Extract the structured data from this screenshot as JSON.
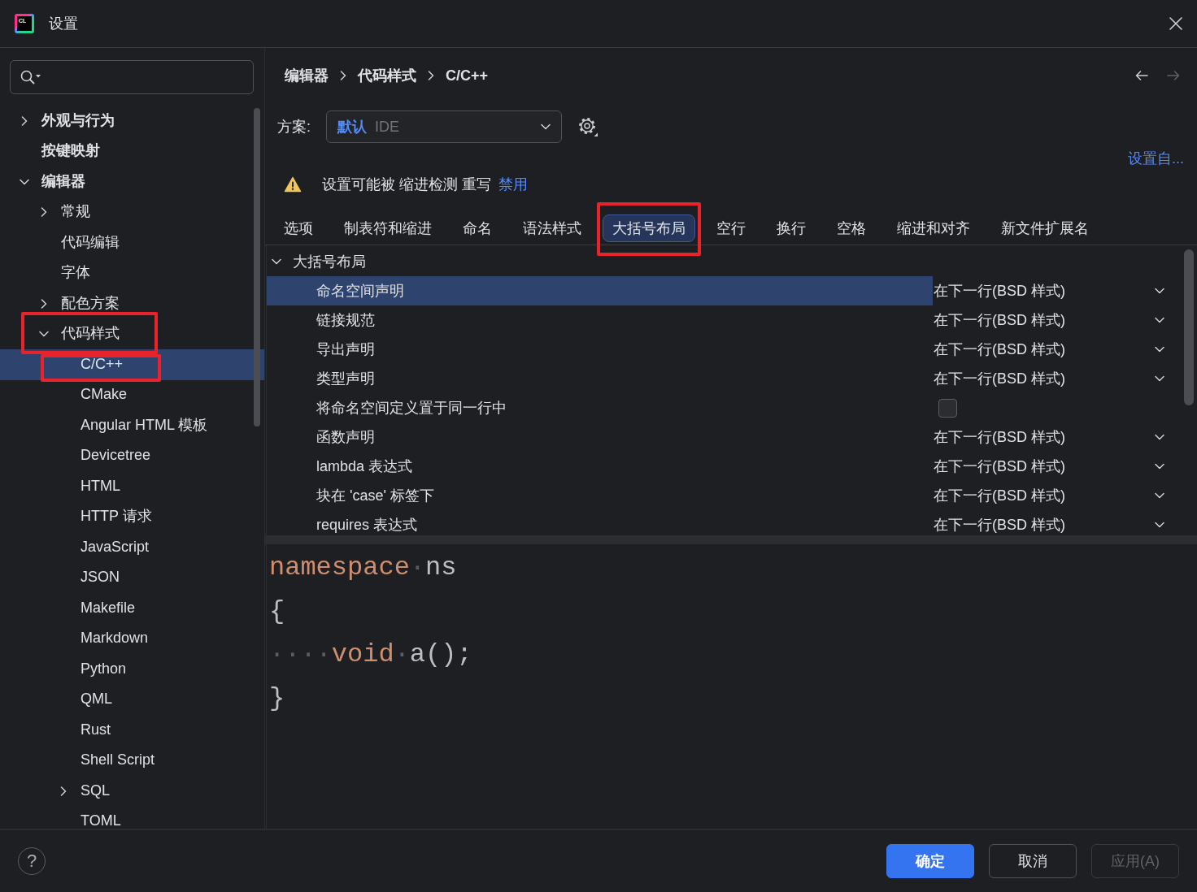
{
  "window": {
    "icon_text": "CL",
    "title": "设置"
  },
  "sidebar": {
    "tree": [
      {
        "label": "外观与行为",
        "expanded": false,
        "selected": false
      },
      {
        "label": "按键映射",
        "selected": false
      },
      {
        "label": "编辑器",
        "expanded": true,
        "selected": false,
        "children": [
          {
            "label": "常规",
            "expanded": false,
            "selected": false
          },
          {
            "label": "代码编辑",
            "selected": false
          },
          {
            "label": "字体",
            "selected": false
          },
          {
            "label": "配色方案",
            "expanded": false,
            "selected": false
          },
          {
            "label": "代码样式",
            "expanded": true,
            "selected": false,
            "annotated": true,
            "children": [
              {
                "label": "C/C++",
                "selected": true,
                "annotated": true
              },
              {
                "label": "CMake",
                "selected": false
              },
              {
                "label": "Angular HTML 模板",
                "selected": false
              },
              {
                "label": "Devicetree",
                "selected": false
              },
              {
                "label": "HTML",
                "selected": false
              },
              {
                "label": "HTTP 请求",
                "selected": false
              },
              {
                "label": "JavaScript",
                "selected": false
              },
              {
                "label": "JSON",
                "selected": false
              },
              {
                "label": "Makefile",
                "selected": false
              },
              {
                "label": "Markdown",
                "selected": false
              },
              {
                "label": "Python",
                "selected": false
              },
              {
                "label": "QML",
                "selected": false
              },
              {
                "label": "Rust",
                "selected": false
              },
              {
                "label": "Shell Script",
                "selected": false
              },
              {
                "label": "SQL",
                "expanded": false,
                "selected": false
              },
              {
                "label": "TOML",
                "selected": false
              }
            ]
          }
        ]
      }
    ]
  },
  "breadcrumb": [
    "编辑器",
    "代码样式",
    "C/C++"
  ],
  "navigation": {
    "back": {
      "disabled": false
    },
    "forward": {
      "disabled": true
    }
  },
  "scheme": {
    "label": "方案:",
    "value": "默认",
    "suffix": "IDE"
  },
  "set_from_link": "设置自...",
  "warning": {
    "text": "设置可能被 缩进检测 重写",
    "link": "禁用"
  },
  "tabs": [
    {
      "label": "选项",
      "selected": false
    },
    {
      "label": "制表符和缩进",
      "selected": false
    },
    {
      "label": "命名",
      "selected": false
    },
    {
      "label": "语法样式",
      "selected": false
    },
    {
      "label": "大括号布局",
      "selected": true,
      "annotated": true
    },
    {
      "label": "空行",
      "selected": false
    },
    {
      "label": "换行",
      "selected": false
    },
    {
      "label": "空格",
      "selected": false
    },
    {
      "label": "缩进和对齐",
      "selected": false
    },
    {
      "label": "新文件扩展名",
      "selected": false
    }
  ],
  "options": {
    "group": {
      "label": "大括号布局",
      "expanded": true
    },
    "rows": [
      {
        "label": "命名空间声明",
        "kind": "dropdown",
        "value": "在下一行(BSD 样式)",
        "selected": true
      },
      {
        "label": "链接规范",
        "kind": "dropdown",
        "value": "在下一行(BSD 样式)",
        "selected": false
      },
      {
        "label": "导出声明",
        "kind": "dropdown",
        "value": "在下一行(BSD 样式)",
        "selected": false
      },
      {
        "label": "类型声明",
        "kind": "dropdown",
        "value": "在下一行(BSD 样式)",
        "selected": false
      },
      {
        "label": "将命名空间定义置于同一行中",
        "kind": "checkbox",
        "checked": false,
        "selected": false
      },
      {
        "label": "函数声明",
        "kind": "dropdown",
        "value": "在下一行(BSD 样式)",
        "selected": false
      },
      {
        "label": "lambda 表达式",
        "kind": "dropdown",
        "value": "在下一行(BSD 样式)",
        "selected": false
      },
      {
        "label": "块在 'case' 标签下",
        "kind": "dropdown",
        "value": "在下一行(BSD 样式)",
        "selected": false
      },
      {
        "label": "requires 表达式",
        "kind": "dropdown",
        "value": "在下一行(BSD 样式)",
        "selected": false
      }
    ]
  },
  "code_preview": {
    "lines": [
      [
        {
          "text": "namespace",
          "kind": "keyword"
        },
        {
          "text": "·",
          "kind": "whitespace"
        },
        {
          "text": "ns",
          "kind": "plain"
        }
      ],
      [
        {
          "text": "{",
          "kind": "plain"
        }
      ],
      [
        {
          "text": "····",
          "kind": "whitespace"
        },
        {
          "text": "void",
          "kind": "keyword"
        },
        {
          "text": "·",
          "kind": "whitespace"
        },
        {
          "text": "a();",
          "kind": "plain"
        }
      ],
      [
        {
          "text": "}",
          "kind": "plain"
        }
      ]
    ]
  },
  "footer": {
    "help": "?",
    "buttons": [
      {
        "label": "确定",
        "kind": "primary",
        "disabled": false
      },
      {
        "label": "取消",
        "kind": "secondary",
        "disabled": false
      },
      {
        "label": "应用(A)",
        "kind": "secondary",
        "disabled": true
      }
    ]
  }
}
